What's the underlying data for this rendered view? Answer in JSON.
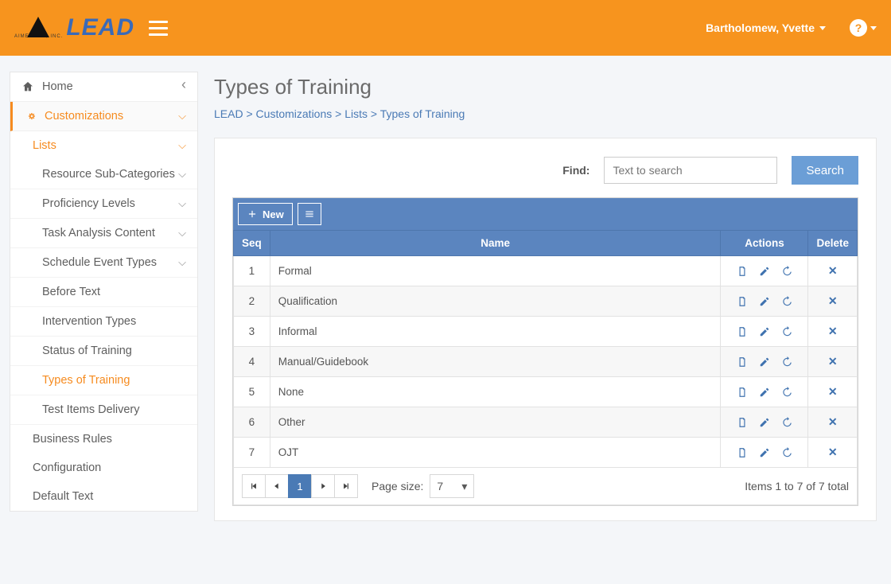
{
  "header": {
    "brand": "LEAD",
    "brand_sub": "AIMEREON, INC.",
    "user": "Bartholomew, Yvette",
    "help": "?"
  },
  "sidebar": {
    "home": "Home",
    "customizations": "Customizations",
    "lists": "Lists",
    "items": [
      "Resource Sub-Categories",
      "Proficiency Levels",
      "Task Analysis Content",
      "Schedule Event Types",
      "Before Text",
      "Intervention Types",
      "Status of Training",
      "Types of Training",
      "Test Items Delivery"
    ],
    "bottom": [
      "Business Rules",
      "Configuration",
      "Default Text"
    ]
  },
  "page": {
    "title": "Types of Training",
    "breadcrumb": [
      "LEAD",
      "Customizations",
      "Lists",
      "Types of Training"
    ]
  },
  "search": {
    "label": "Find:",
    "placeholder": "Text to search",
    "button": "Search"
  },
  "toolbar": {
    "new": "New"
  },
  "table": {
    "headers": {
      "seq": "Seq",
      "name": "Name",
      "actions": "Actions",
      "delete": "Delete"
    },
    "rows": [
      {
        "seq": "1",
        "name": "Formal"
      },
      {
        "seq": "2",
        "name": "Qualification"
      },
      {
        "seq": "3",
        "name": "Informal"
      },
      {
        "seq": "4",
        "name": "Manual/Guidebook"
      },
      {
        "seq": "5",
        "name": "None"
      },
      {
        "seq": "6",
        "name": "Other"
      },
      {
        "seq": "7",
        "name": "OJT"
      }
    ]
  },
  "pager": {
    "page_size_label": "Page size:",
    "page_size": "7",
    "current": "1",
    "status": "Items 1 to 7 of 7 total"
  }
}
